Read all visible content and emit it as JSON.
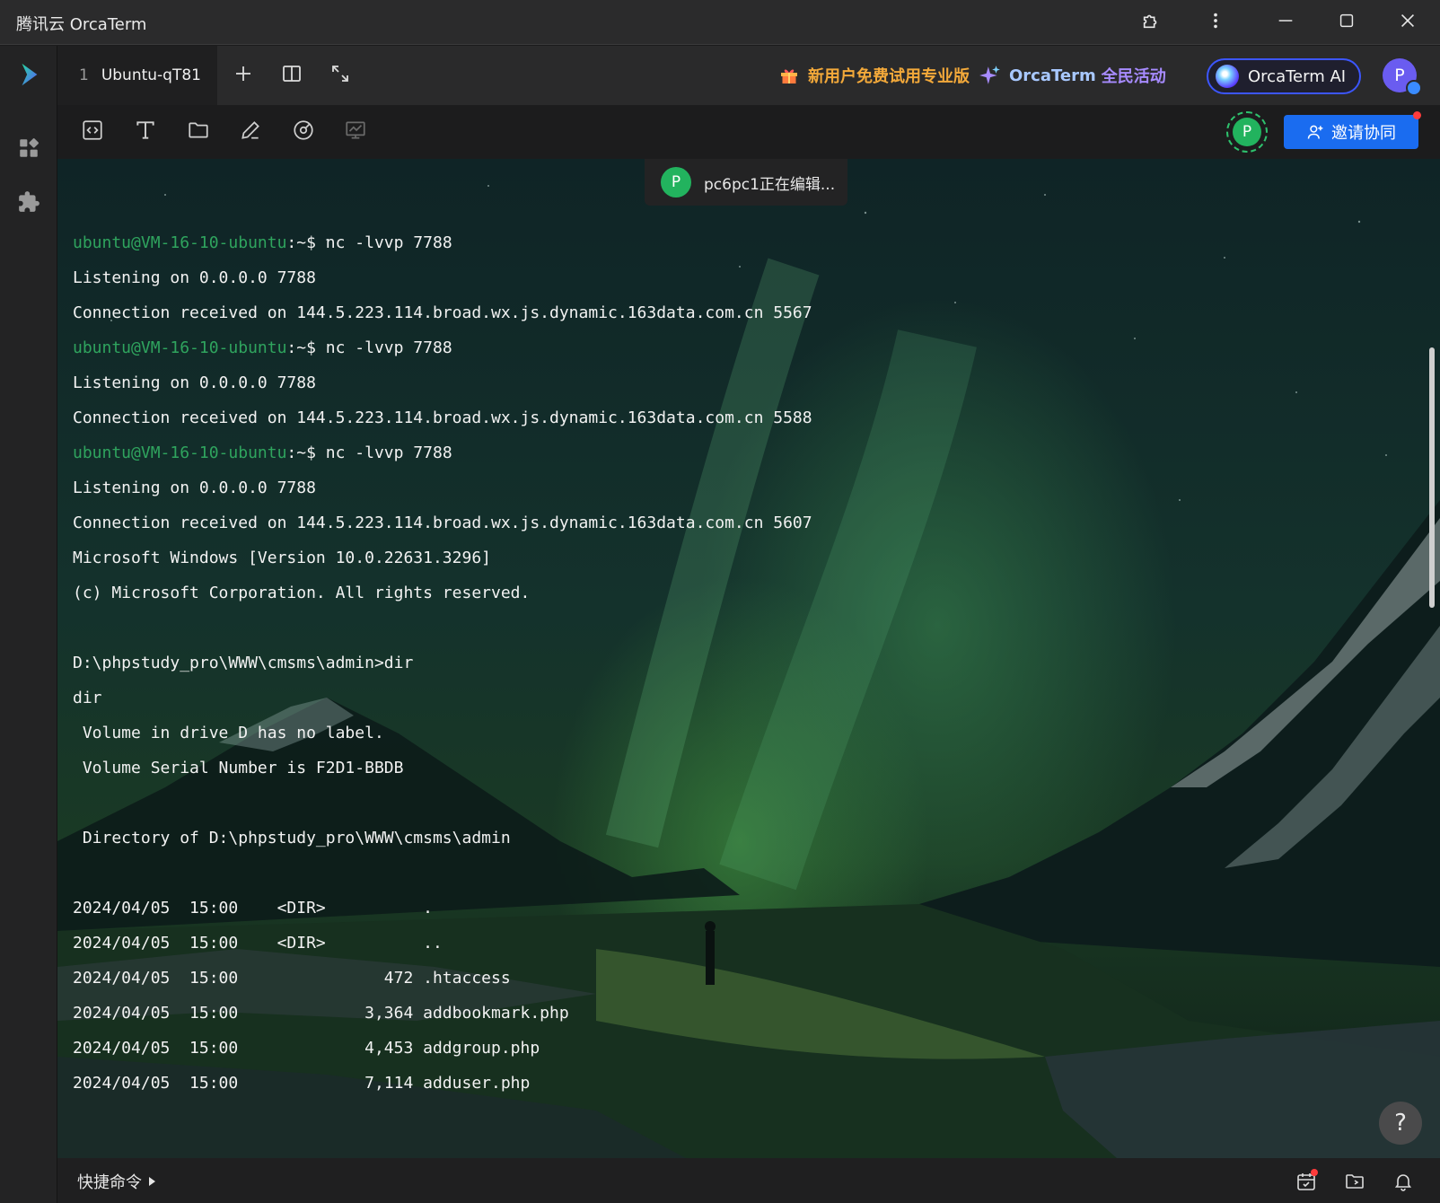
{
  "window": {
    "title": "腾讯云 OrcaTerm"
  },
  "tabs": [
    {
      "index": "1",
      "name": "Ubuntu-qT81"
    }
  ],
  "promos": {
    "trial": "新用户免费试用专业版",
    "event_brand": "OrcaTerm",
    "event_text": "全民活动",
    "ai": "OrcaTerm AI"
  },
  "user": {
    "avatar_letter": "P"
  },
  "toolbar": {
    "collaborator_letter": "P",
    "invite_label": "邀请协同"
  },
  "editing": {
    "avatar_letter": "P",
    "text": "pc6pc1正在编辑..."
  },
  "terminal": {
    "lines": [
      {
        "user": "ubuntu@VM-16-10-ubuntu",
        "rest": ":~$ nc -lvvp 7788"
      },
      {
        "text": "Listening on 0.0.0.0 7788"
      },
      {
        "text": "Connection received on 144.5.223.114.broad.wx.js.dynamic.163data.com.cn 5567"
      },
      {
        "user": "ubuntu@VM-16-10-ubuntu",
        "rest": ":~$ nc -lvvp 7788"
      },
      {
        "text": "Listening on 0.0.0.0 7788"
      },
      {
        "text": "Connection received on 144.5.223.114.broad.wx.js.dynamic.163data.com.cn 5588"
      },
      {
        "user": "ubuntu@VM-16-10-ubuntu",
        "rest": ":~$ nc -lvvp 7788"
      },
      {
        "text": "Listening on 0.0.0.0 7788"
      },
      {
        "text": "Connection received on 144.5.223.114.broad.wx.js.dynamic.163data.com.cn 5607"
      },
      {
        "text": "Microsoft Windows [Version 10.0.22631.3296]"
      },
      {
        "text": "(c) Microsoft Corporation. All rights reserved."
      },
      {
        "text": ""
      },
      {
        "text": "D:\\phpstudy_pro\\WWW\\cmsms\\admin>dir"
      },
      {
        "text": "dir"
      },
      {
        "text": " Volume in drive D has no label."
      },
      {
        "text": " Volume Serial Number is F2D1-BBDB"
      },
      {
        "text": ""
      },
      {
        "text": " Directory of D:\\phpstudy_pro\\WWW\\cmsms\\admin"
      },
      {
        "text": ""
      },
      {
        "text": "2024/04/05  15:00    <DIR>          ."
      },
      {
        "text": "2024/04/05  15:00    <DIR>          .."
      },
      {
        "text": "2024/04/05  15:00               472 .htaccess"
      },
      {
        "text": "2024/04/05  15:00             3,364 addbookmark.php"
      },
      {
        "text": "2024/04/05  15:00             4,453 addgroup.php"
      },
      {
        "text": "2024/04/05  15:00             7,114 adduser.php"
      }
    ]
  },
  "help": {
    "label": "?"
  },
  "statusbar": {
    "quick_commands": "快捷命令"
  },
  "icons": {
    "rail": [
      "app-logo-icon",
      "apps-grid-icon",
      "plugin-icon"
    ],
    "window": [
      "extension-icon",
      "more-vertical-icon",
      "minimize-icon",
      "maximize-icon",
      "close-icon"
    ],
    "tabbar": [
      "add-tab-icon",
      "split-view-icon",
      "expand-icon",
      "gift-icon",
      "sparkle-icon"
    ],
    "toolbar": [
      "code-icon",
      "text-icon",
      "folder-icon",
      "edit-icon",
      "monitor-icon",
      "chart-icon"
    ],
    "statusbar": [
      "calendar-icon",
      "folder-sync-icon",
      "bell-icon"
    ]
  },
  "colors": {
    "prompt_user": "#2fa45e",
    "accent_blue": "#1a6cf0",
    "promo_gold": "#f3a93a",
    "promo_purple": "#a78bff",
    "collab_green": "#22b35e"
  }
}
